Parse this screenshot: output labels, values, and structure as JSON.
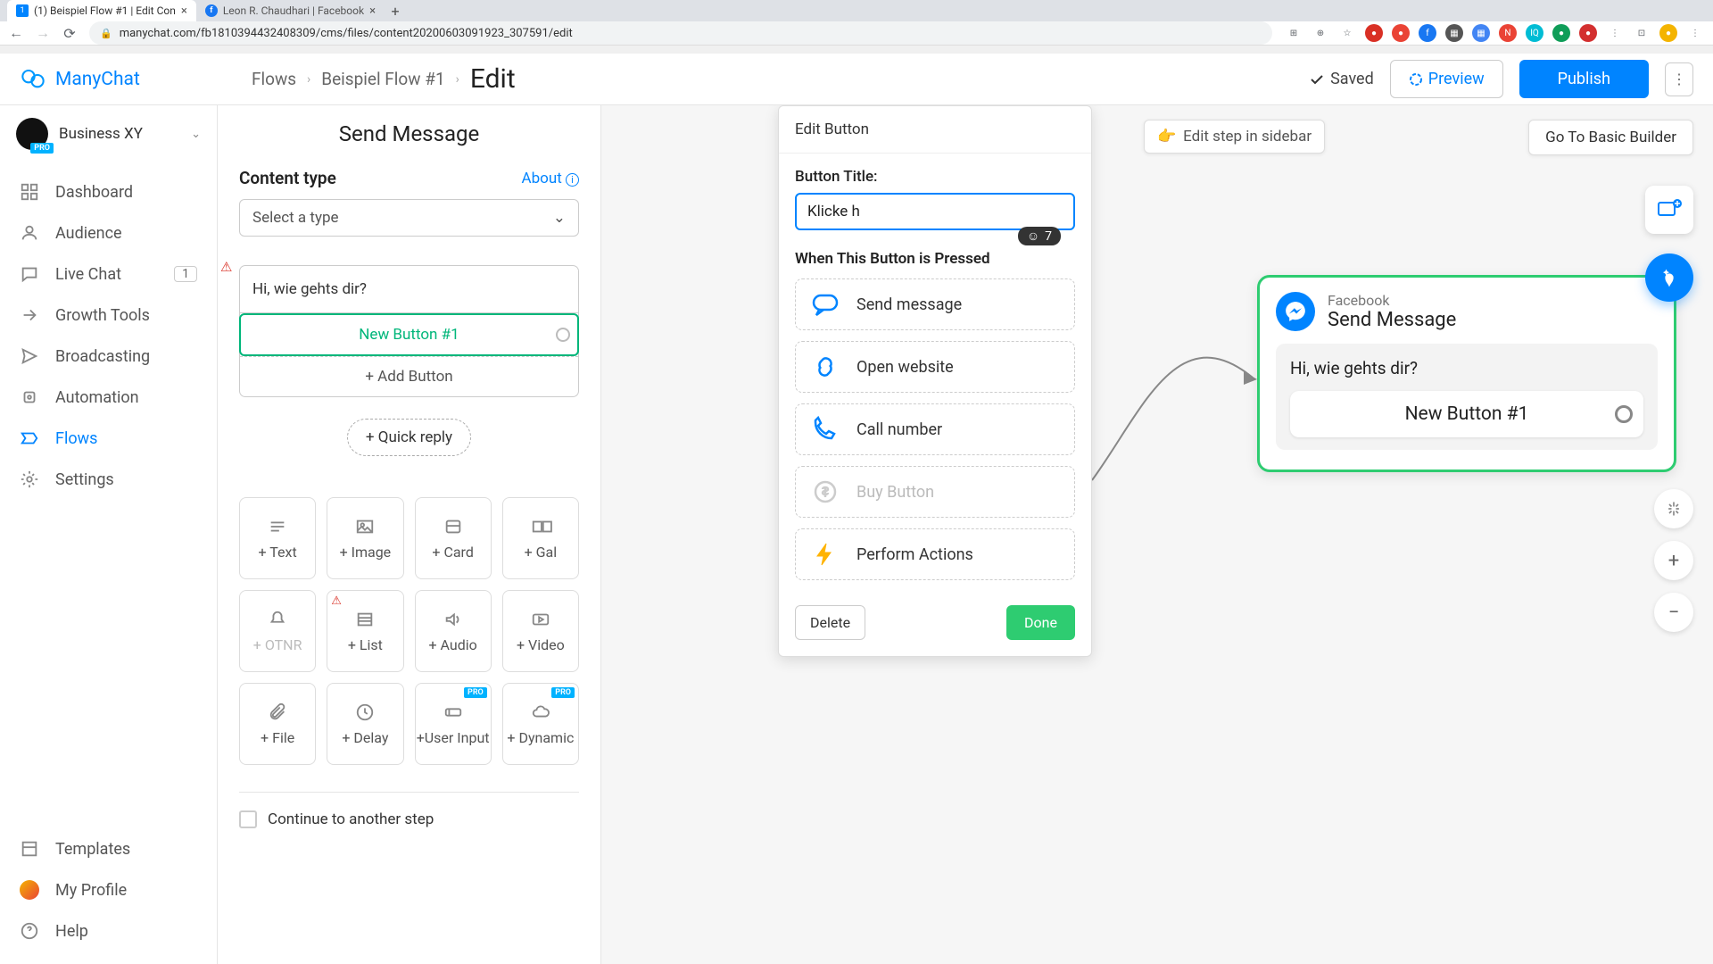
{
  "browser": {
    "tabs": [
      {
        "title": "(1) Beispiel Flow #1 | Edit Con",
        "favicon": "1"
      },
      {
        "title": "Leon R. Chaudhari | Facebook",
        "favicon": "f"
      }
    ],
    "url": "manychat.com/fb181039443240830​9/cms/files/content20200603091923_307591/edit"
  },
  "brand": "ManyChat",
  "breadcrumb": {
    "flows": "Flows",
    "flow_name": "Beispiel Flow #1",
    "edit": "Edit"
  },
  "top_actions": {
    "saved": "Saved",
    "preview": "Preview",
    "publish": "Publish"
  },
  "account": {
    "name": "Business XY",
    "badge": "PRO"
  },
  "sidebar": {
    "items": [
      {
        "label": "Dashboard"
      },
      {
        "label": "Audience"
      },
      {
        "label": "Live Chat",
        "badge": "1"
      },
      {
        "label": "Growth Tools"
      },
      {
        "label": "Broadcasting"
      },
      {
        "label": "Automation"
      },
      {
        "label": "Flows"
      },
      {
        "label": "Settings"
      }
    ],
    "bottom": [
      {
        "label": "Templates"
      },
      {
        "label": "My Profile"
      },
      {
        "label": "Help"
      }
    ]
  },
  "send_message": {
    "title": "Send Message",
    "content_type_label": "Content type",
    "about": "About",
    "select_placeholder": "Select a type",
    "message_text": "Hi, wie gehts dir?",
    "button_label": "New Button #1",
    "add_button": "+ Add Button",
    "quick_reply": "+ Quick reply",
    "blocks": [
      "+ Text",
      "+ Image",
      "+ Card",
      "+ Gal",
      "+ OTNR",
      "+ List",
      "+ Audio",
      "+ Video",
      "+ File",
      "+ Delay",
      "+User Input",
      "+ Dynamic"
    ],
    "continue": "Continue to another step"
  },
  "popover": {
    "title": "Edit Button",
    "field_label": "Button Title:",
    "input_value": "Klicke h",
    "char_remaining": "7",
    "section": "When This Button is Pressed",
    "actions": [
      "Send message",
      "Open website",
      "Call number",
      "Buy Button",
      "Perform Actions"
    ],
    "delete": "Delete",
    "done": "Done"
  },
  "canvas": {
    "edit_step": "Edit step in sidebar",
    "basic_builder": "Go To Basic Builder",
    "node": {
      "source": "Facebook",
      "title": "Send Message",
      "msg": "Hi, wie gehts dir?",
      "btn": "New Button #1"
    }
  }
}
